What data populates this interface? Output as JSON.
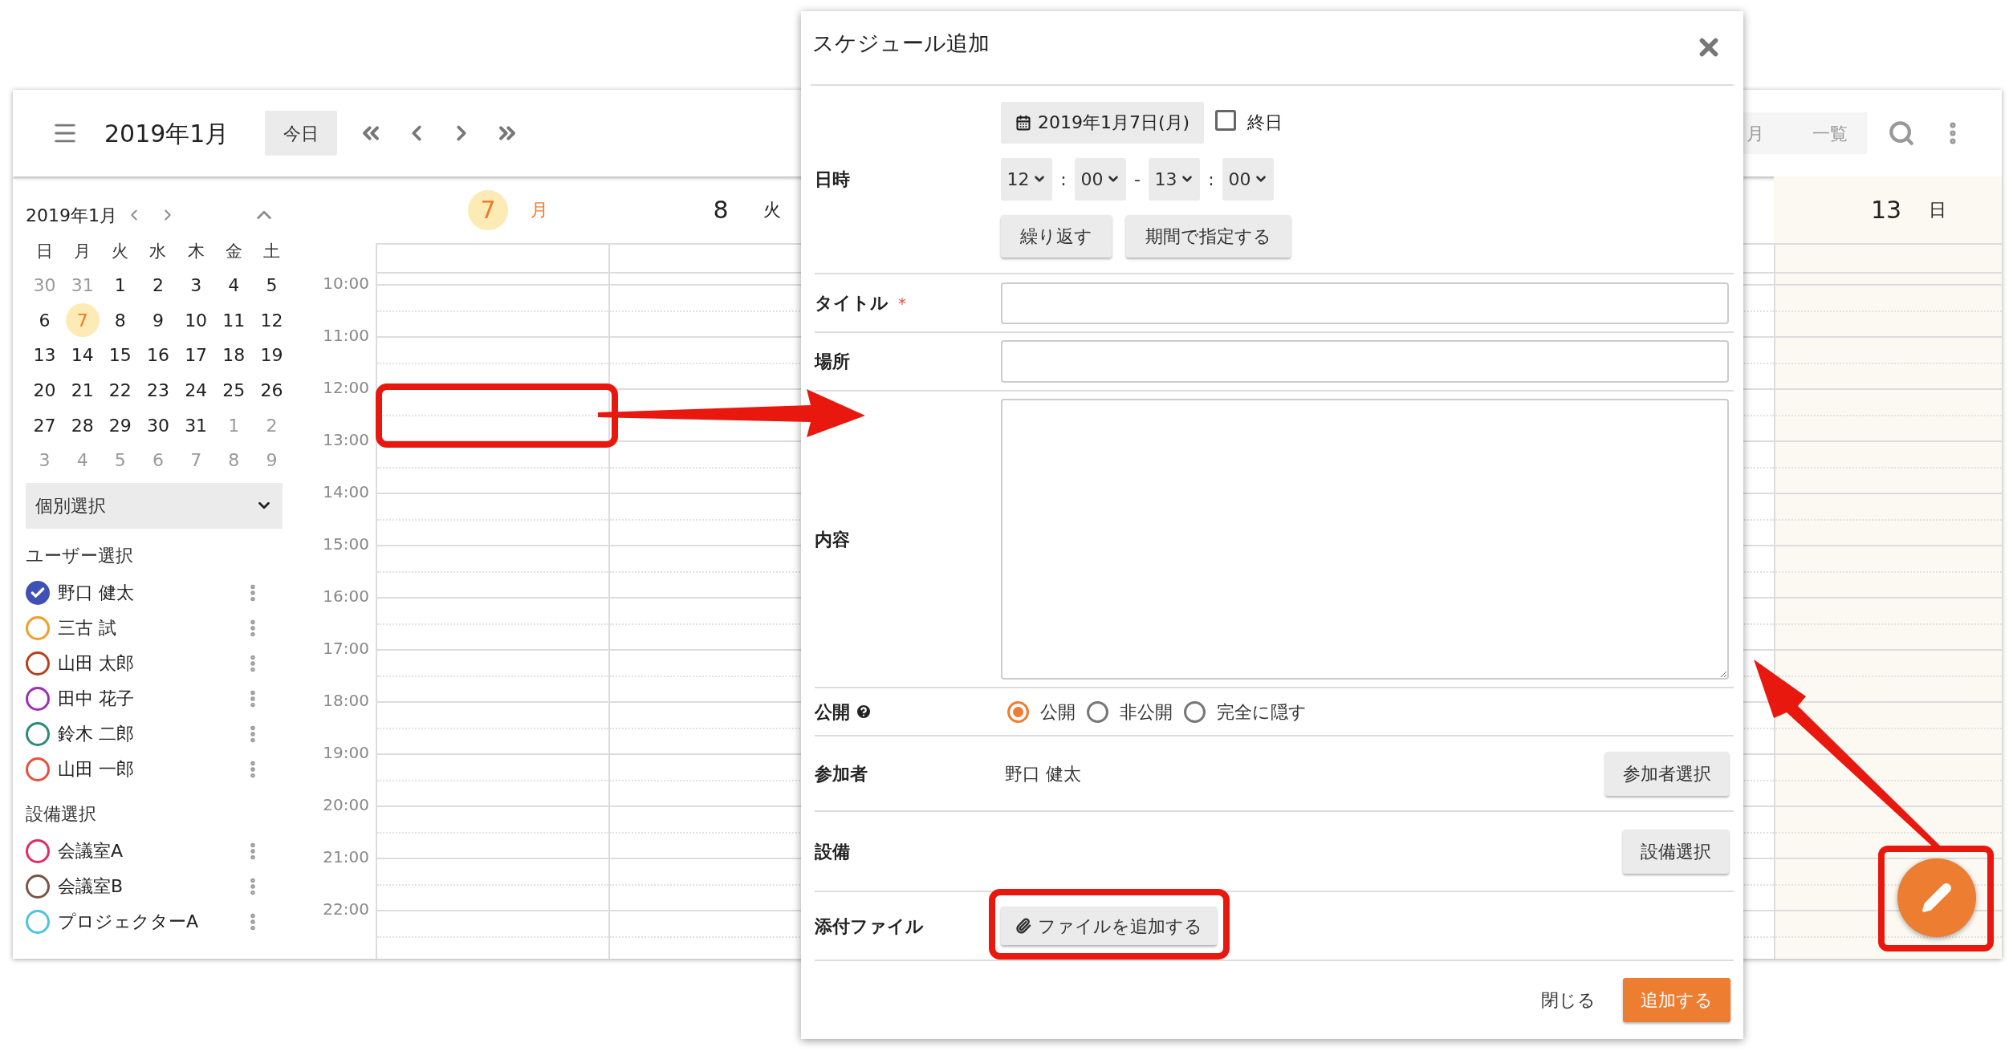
{
  "app": {
    "title": "2019年1月",
    "today_button": "今日",
    "view_buttons": [
      "月",
      "一覧"
    ]
  },
  "mini_calendar": {
    "title": "2019年1月",
    "weekdays": [
      "日",
      "月",
      "火",
      "水",
      "木",
      "金",
      "土"
    ],
    "weeks": [
      [
        {
          "label": "30",
          "muted": true,
          "selected": false
        },
        {
          "label": "31",
          "muted": true,
          "selected": false
        },
        {
          "label": "1",
          "muted": false,
          "selected": false
        },
        {
          "label": "2",
          "muted": false,
          "selected": false
        },
        {
          "label": "3",
          "muted": false,
          "selected": false
        },
        {
          "label": "4",
          "muted": false,
          "selected": false
        },
        {
          "label": "5",
          "muted": false,
          "selected": false
        }
      ],
      [
        {
          "label": "6",
          "muted": false,
          "selected": false
        },
        {
          "label": "7",
          "muted": false,
          "selected": true
        },
        {
          "label": "8",
          "muted": false,
          "selected": false
        },
        {
          "label": "9",
          "muted": false,
          "selected": false
        },
        {
          "label": "10",
          "muted": false,
          "selected": false
        },
        {
          "label": "11",
          "muted": false,
          "selected": false
        },
        {
          "label": "12",
          "muted": false,
          "selected": false
        }
      ],
      [
        {
          "label": "13",
          "muted": false,
          "selected": false
        },
        {
          "label": "14",
          "muted": false,
          "selected": false
        },
        {
          "label": "15",
          "muted": false,
          "selected": false
        },
        {
          "label": "16",
          "muted": false,
          "selected": false
        },
        {
          "label": "17",
          "muted": false,
          "selected": false
        },
        {
          "label": "18",
          "muted": false,
          "selected": false
        },
        {
          "label": "19",
          "muted": false,
          "selected": false
        }
      ],
      [
        {
          "label": "20",
          "muted": false,
          "selected": false
        },
        {
          "label": "21",
          "muted": false,
          "selected": false
        },
        {
          "label": "22",
          "muted": false,
          "selected": false
        },
        {
          "label": "23",
          "muted": false,
          "selected": false
        },
        {
          "label": "24",
          "muted": false,
          "selected": false
        },
        {
          "label": "25",
          "muted": false,
          "selected": false
        },
        {
          "label": "26",
          "muted": false,
          "selected": false
        }
      ],
      [
        {
          "label": "27",
          "muted": false,
          "selected": false
        },
        {
          "label": "28",
          "muted": false,
          "selected": false
        },
        {
          "label": "29",
          "muted": false,
          "selected": false
        },
        {
          "label": "30",
          "muted": false,
          "selected": false
        },
        {
          "label": "31",
          "muted": false,
          "selected": false
        },
        {
          "label": "1",
          "muted": true,
          "selected": false
        },
        {
          "label": "2",
          "muted": true,
          "selected": false
        }
      ],
      [
        {
          "label": "3",
          "muted": true,
          "selected": false
        },
        {
          "label": "4",
          "muted": true,
          "selected": false
        },
        {
          "label": "5",
          "muted": true,
          "selected": false
        },
        {
          "label": "6",
          "muted": true,
          "selected": false
        },
        {
          "label": "7",
          "muted": true,
          "selected": false
        },
        {
          "label": "8",
          "muted": true,
          "selected": false
        },
        {
          "label": "9",
          "muted": true,
          "selected": false
        }
      ]
    ]
  },
  "filter_select": {
    "value": "個別選択"
  },
  "user_section": {
    "heading": "ユーザー選択",
    "items": [
      {
        "name": "野口 健太",
        "color": "#3f51b5",
        "checked": true
      },
      {
        "name": "三古 試",
        "color": "#f39c2b",
        "checked": false
      },
      {
        "name": "山田 太郎",
        "color": "#b5401f",
        "checked": false
      },
      {
        "name": "田中 花子",
        "color": "#9c2fb5",
        "checked": false
      },
      {
        "name": "鈴木 二郎",
        "color": "#2a8a7c",
        "checked": false
      },
      {
        "name": "山田 一郎",
        "color": "#e8503c",
        "checked": false
      }
    ]
  },
  "equipment_section": {
    "heading": "設備選択",
    "items": [
      {
        "name": "会議室A",
        "color": "#e02c63",
        "checked": false
      },
      {
        "name": "会議室B",
        "color": "#7a5548",
        "checked": false
      },
      {
        "name": "プロジェクターA",
        "color": "#4cc3e0",
        "checked": false
      }
    ]
  },
  "day_columns": [
    {
      "date": "7",
      "weekday": "月",
      "selected": true,
      "weekend": false
    },
    {
      "date": "8",
      "weekday": "火",
      "selected": false,
      "weekend": false
    },
    {
      "date": "13",
      "weekday": "日",
      "selected": false,
      "weekend": true
    }
  ],
  "time_labels": [
    "10:00",
    "11:00",
    "12:00",
    "13:00",
    "14:00",
    "15:00",
    "16:00",
    "17:00",
    "18:00",
    "19:00",
    "20:00",
    "21:00",
    "22:00"
  ],
  "dialog": {
    "title": "スケジュール追加",
    "datetime": {
      "label": "日時",
      "date_button": "2019年1月7日(月)",
      "all_day": {
        "label": "終日",
        "checked": false
      },
      "time_selects": [
        "12",
        "00",
        "13",
        "00"
      ],
      "separators": [
        ":",
        "-",
        ":"
      ],
      "buttons": [
        "繰り返す",
        "期間で指定する"
      ]
    },
    "title_field": {
      "label": "タイトル",
      "required_mark": "*"
    },
    "place_field": {
      "label": "場所"
    },
    "content_field": {
      "label": "内容"
    },
    "visibility": {
      "label": "公開",
      "options": [
        {
          "label": "公開",
          "selected": true
        },
        {
          "label": "非公開",
          "selected": false
        },
        {
          "label": "完全に隠す",
          "selected": false
        }
      ]
    },
    "participants": {
      "label": "参加者",
      "value": "野口 健太",
      "button": "参加者選択"
    },
    "equipment": {
      "label": "設備",
      "button": "設備選択"
    },
    "attachment": {
      "label": "添付ファイル",
      "button": "ファイルを追加する"
    },
    "footer": {
      "close": "閉じる",
      "submit": "追加する"
    }
  }
}
